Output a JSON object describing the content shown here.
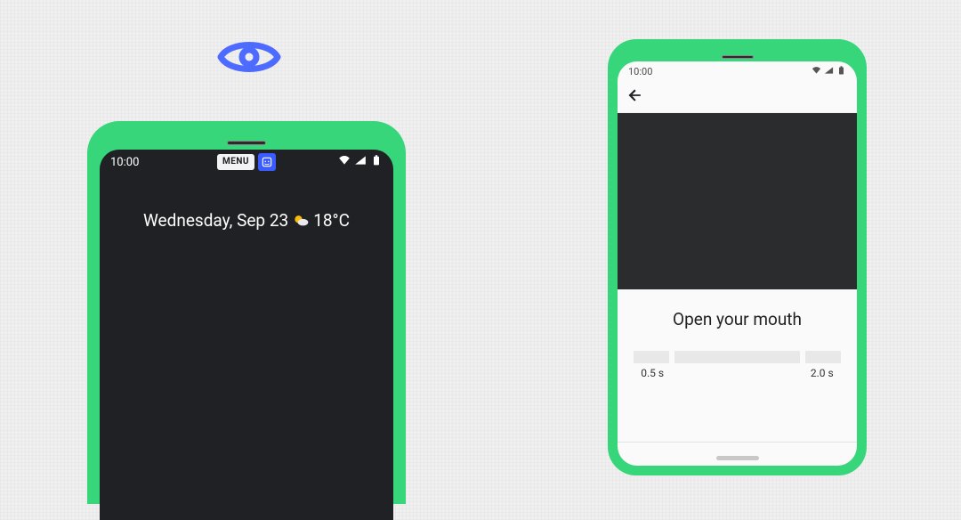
{
  "overlay": {
    "icon_name": "eye-icon"
  },
  "left_phone": {
    "status": {
      "time": "10:00",
      "menu_pill": "MENU",
      "face_switch_icon": "face-switch-icon",
      "wifi_icon": "wifi-icon",
      "signal_icon": "signal-icon",
      "battery_icon": "battery-icon"
    },
    "home": {
      "date_text": "Wednesday, Sep 23",
      "weather_icon": "partly-cloudy-icon",
      "temperature": "18°C"
    }
  },
  "right_phone": {
    "status": {
      "time": "10:00",
      "wifi_icon": "wifi-icon",
      "signal_icon": "signal-icon",
      "battery_icon": "battery-icon"
    },
    "topbar": {
      "back_icon": "back-arrow-icon"
    },
    "instruction": "Open your mouth",
    "slider": {
      "label_min": "0.5 s",
      "label_max": "2.0 s"
    },
    "nav_pill": "home-gesture-pill"
  }
}
